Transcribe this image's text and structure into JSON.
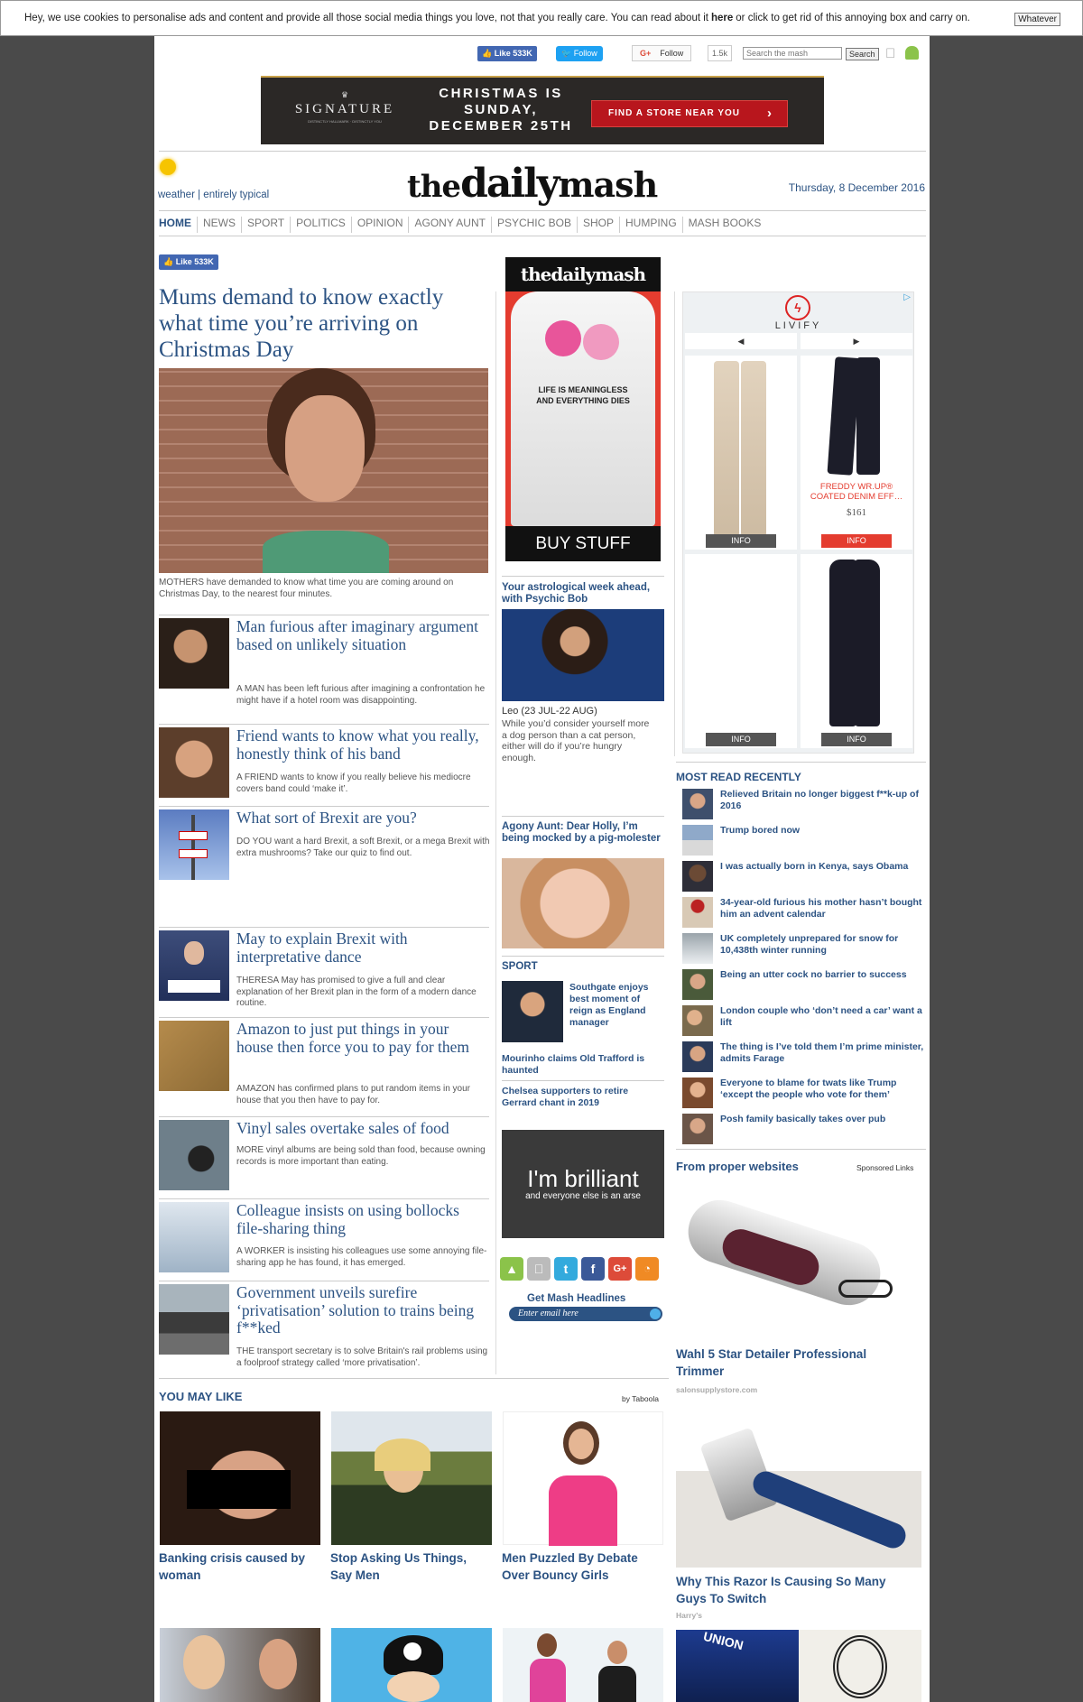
{
  "cookie": {
    "text_before": "Hey, we use cookies to personalise ads and content and provide all those social media things you love, not that you really care. You can read about it",
    "here_link": "here",
    "text_after": "or click to get rid of this annoying box and carry on.",
    "dismiss": "Whatever"
  },
  "topbar": {
    "fb_like": "Like 533K",
    "tw_follow": "Follow",
    "gp_follow": "Follow",
    "gp_count": "1.5k",
    "search_placeholder": "Search the mash",
    "search_button": "Search"
  },
  "banner": {
    "brand": "SIGNATURE",
    "brand_sub": "DISTINCTLY HALLMARK · DISTINCTLY YOU",
    "headline_1": "CHRISTMAS IS",
    "headline_2": "SUNDAY,",
    "headline_3": "DECEMBER 25TH",
    "cta": "FIND A STORE NEAR YOU",
    "cta_arrow": "›"
  },
  "masthead": {
    "weather_link": "weather",
    "weather_desc": "| entirely typical",
    "logo_left": "the",
    "logo_mid": "daily",
    "logo_right": "mash",
    "date": "Thursday, 8 December 2016"
  },
  "nav": {
    "items": [
      "HOME",
      "NEWS",
      "SPORT",
      "POLITICS",
      "OPINION",
      "AGONY AUNT",
      "PSYCHIC BOB",
      "SHOP",
      "HUMPING",
      "MASH BOOKS"
    ]
  },
  "lead": {
    "fb_like": "Like 533K",
    "title": "Mums demand to know exactly what time you’re arriving on Christmas Day",
    "caption": "MOTHERS have demanded to know what time you are coming around on Christmas Day, to the nearest four minutes."
  },
  "stories": [
    {
      "title": "Man furious after imaginary argument based on unlikely situation",
      "summary": "A MAN has been left furious after imagining a confrontation he might have if a hotel room was disappointing."
    },
    {
      "title": "Friend wants to know what you really, honestly think of his band",
      "summary": "A FRIEND wants to know if you really believe his mediocre covers band could ‘make it’."
    },
    {
      "title": "What sort of Brexit are you?",
      "summary": "DO YOU want a hard Brexit, a soft Brexit, or a mega Brexit with extra mushrooms? Take our quiz to find out."
    },
    {
      "title": "May to explain Brexit with interpretative dance",
      "summary": "THERESA May has promised to give a full and clear explanation of her Brexit plan in the form of a modern dance routine."
    },
    {
      "title": "Amazon to just put things in your house then force you to pay for them",
      "summary": "AMAZON has confirmed plans to put random items in your house that you then have to pay for."
    },
    {
      "title": "Vinyl sales overtake sales of food",
      "summary": "MORE vinyl albums are being sold than food, because owning records is more important than eating."
    },
    {
      "title": "Colleague insists on using bollocks file-sharing thing",
      "summary": "A WORKER is insisting his colleagues use some annoying file-sharing app he has found, it has emerged."
    },
    {
      "title": "Government unveils surefire ‘privatisation’ solution to trains being f**ked",
      "summary": "THE transport secretary is to solve Britain's rail problems using a foolproof strategy called ‘more privatisation’."
    }
  ],
  "shop": {
    "logo": "thedailymash",
    "shirt_line1": "LIFE IS MEANINGLESS",
    "shirt_line2": "AND EVERYTHING DIES",
    "button": "BUY STUFF"
  },
  "psychic": {
    "heading": "Your astrological week ahead, with Psychic Bob",
    "sign": "Leo (23 JUL-22 AUG)",
    "text": "While you’d consider yourself more a dog person than a cat person, either will do if you’re hungry enough."
  },
  "agony": {
    "heading": "Agony Aunt: Dear Holly, I’m being mocked by a pig-molester"
  },
  "sport": {
    "label": "SPORT",
    "main": "Southgate enjoys best moment of reign as England manager",
    "items": [
      "Mourinho claims Old Trafford is haunted",
      "Chelsea supporters to retire Gerrard chant in 2019"
    ]
  },
  "brilliant": {
    "line1": "I'm brilliant",
    "line2": "and everyone else is an arse"
  },
  "apps": {
    "icons": [
      "android-icon",
      "apple-icon",
      "twitter-icon",
      "facebook-icon",
      "google-plus-icon",
      "rss-icon"
    ],
    "headlines_label": "Get Mash Headlines",
    "email_placeholder": "Enter email here"
  },
  "ad": {
    "brand": "LIVIFY",
    "prev": "◀",
    "next": "▶",
    "product_name": "FREDDY WR.UP® COATED DENIM EFF…",
    "price": "$161",
    "info_label": "INFO",
    "ad_choices": "▷"
  },
  "most_read": {
    "heading": "MOST READ RECENTLY",
    "items": [
      "Relieved Britain no longer biggest f**k-up of 2016",
      "Trump bored now",
      "I was actually born in Kenya, says Obama",
      "34-year-old furious his mother hasn’t bought him an advent calendar",
      "UK completely unprepared for snow for 10,438th winter running",
      "Being an utter cock no barrier to success",
      "London couple who ‘don’t need a car’ want a lift",
      "The thing is I’ve told them I’m prime minister, admits Farage",
      "Everyone to blame for twats like Trump ‘except the people who vote for them’",
      "Posh family basically takes over pub"
    ]
  },
  "proper": {
    "heading": "From proper websites",
    "sponsored": "Sponsored Links",
    "items": [
      {
        "title": "Wahl 5 Star Detailer Professional Trimmer",
        "source": "salonsupplystore.com"
      },
      {
        "title": "Why This Razor Is Causing So Many Guys To Switch",
        "source": "Harry's"
      }
    ]
  },
  "you_may_like": {
    "heading": "YOU MAY LIKE",
    "by": "by Taboola",
    "items": [
      {
        "title": "Banking crisis caused by woman"
      },
      {
        "title": "Stop Asking Us Things, Say Men"
      },
      {
        "title": "Men Puzzled By Debate Over Bouncy Girls"
      }
    ]
  },
  "colors": {
    "link_blue": "#2c5383",
    "fb_blue": "#4267b2",
    "tw_blue": "#1da1f2",
    "banner_red": "#b8161d",
    "shop_red": "#e43c2f"
  }
}
